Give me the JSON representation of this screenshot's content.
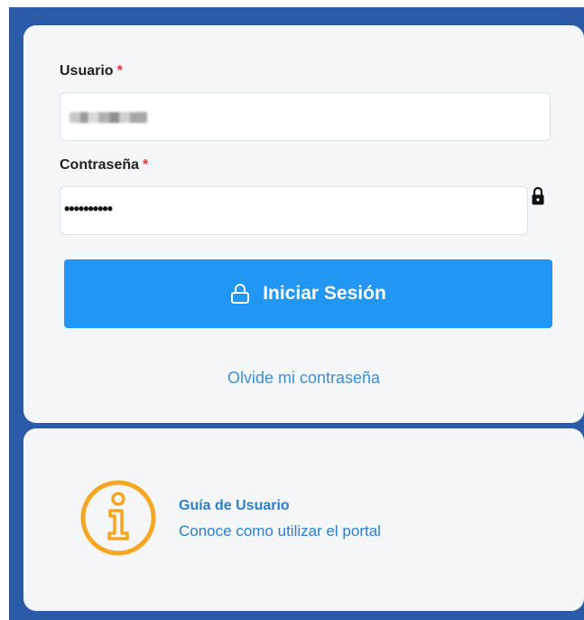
{
  "login": {
    "username_label": "Usuario",
    "username_required": "*",
    "username_value": "",
    "password_label": "Contraseña",
    "password_required": "*",
    "password_value": "••••••••••",
    "submit_label": "Iniciar Sesión",
    "forgot_label": "Olvide mi contraseña"
  },
  "guide": {
    "title": "Guía de Usuario",
    "subtitle": "Conoce como utilizar el portal"
  },
  "colors": {
    "primary": "#2196f3",
    "link": "#2a7fcf",
    "required": "#e53935",
    "info_icon": "#f5a623",
    "frame": "#2a5aa8"
  },
  "icons": {
    "button_icon": "lock-icon",
    "field_icon": "lock-icon",
    "guide_icon": "info-icon"
  }
}
